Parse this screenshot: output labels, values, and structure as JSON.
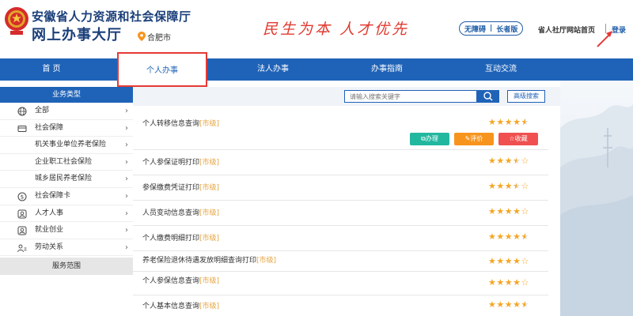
{
  "header": {
    "title_line1": "安徽省人力资源和社会保障厅",
    "title_line2": "网上办事大厅",
    "location": "合肥市",
    "slogan": "民生为本 人才优先",
    "accessibility": "无障碍",
    "elder_mode": "长者版",
    "home_link": "省人社厅网站首页",
    "login": "登录",
    "icons": {
      "emblem": "national-emblem-icon",
      "location": "location-pin-icon",
      "arrow": "red-arrow-icon"
    }
  },
  "nav": {
    "items": [
      {
        "label": "首 页"
      },
      {
        "label": "个人办事"
      },
      {
        "label": "法人办事"
      },
      {
        "label": "办事指南"
      },
      {
        "label": "互动交流"
      }
    ],
    "active_index": 1
  },
  "sidebar": {
    "header": "业务类型",
    "items": [
      {
        "label": "全部",
        "icon": "globe-icon"
      },
      {
        "label": "社会保障",
        "icon": "card-icon"
      },
      {
        "label": "机关事业单位养老保险",
        "icon": ""
      },
      {
        "label": "企业职工社会保险",
        "icon": ""
      },
      {
        "label": "城乡居民养老保险",
        "icon": ""
      },
      {
        "label": "社会保障卡",
        "icon": "social-card-icon"
      },
      {
        "label": "人才人事",
        "icon": "person-icon"
      },
      {
        "label": "就业创业",
        "icon": "briefcase-icon"
      },
      {
        "label": "劳动关系",
        "icon": "people-icon"
      }
    ],
    "footer": "服务范围"
  },
  "search": {
    "placeholder": "请输入搜索关键字",
    "advanced": "高级搜索"
  },
  "services": [
    {
      "name": "个人转移信息查询",
      "tag": "[市级]",
      "rating": 4.5
    },
    {
      "name": "个人参保证明打印",
      "tag": "[市级]",
      "rating": 3.5
    },
    {
      "name": "参保缴费凭证打印",
      "tag": "[市级]",
      "rating": 3.5
    },
    {
      "name": "人员变动信息查询",
      "tag": "[市级]",
      "rating": 4.0
    },
    {
      "name": "个人缴费明细打印",
      "tag": "[市级]",
      "rating": 4.5
    },
    {
      "name": "养老保险退休待遇发放明细查询打印",
      "tag": "[市级]",
      "rating": 4.0
    },
    {
      "name": "个人参保信息查询",
      "tag": "[市级]",
      "rating": 4.0
    },
    {
      "name": "个人基本信息查询",
      "tag": "[市级]",
      "rating": 4.5
    }
  ],
  "actions": {
    "handle": "办理",
    "evaluate": "评价",
    "favorite": "收藏"
  },
  "colors": {
    "primary": "#1f63b8",
    "accent_red": "#e53935",
    "star": "#f5a623",
    "tag": "#e6a23c"
  }
}
